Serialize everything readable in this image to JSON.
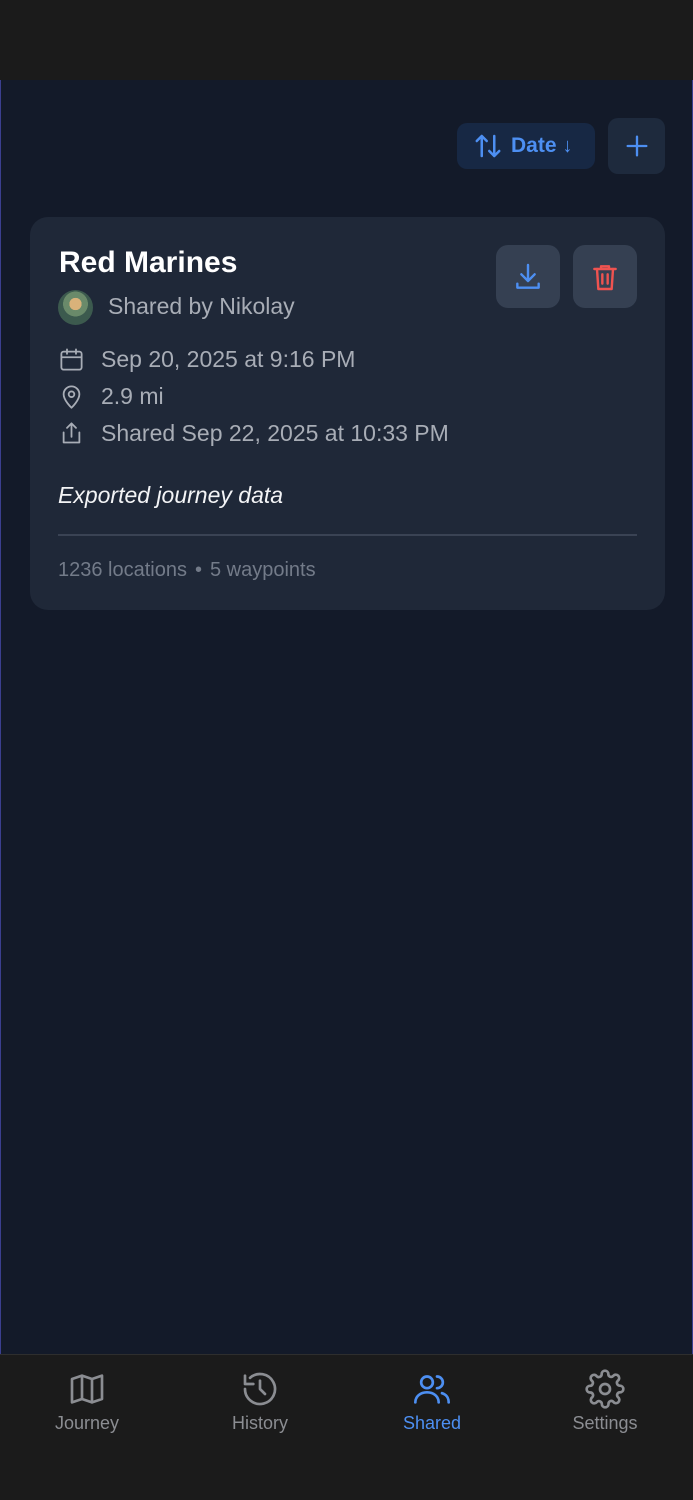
{
  "toolbar": {
    "sort_label": "Date",
    "sort_direction": "↓",
    "sort_icon": "arrows-up-down-icon",
    "add_icon": "plus-icon"
  },
  "card": {
    "title": "Red Marines",
    "shared_by": "Shared by Nikolay",
    "date": "Sep 20, 2025 at 9:16 PM",
    "distance": "2.9 mi",
    "shared_at": "Shared Sep 22, 2025 at 10:33 PM",
    "description": "Exported journey data",
    "locations": "1236 locations",
    "separator": "•",
    "waypoints": "5 waypoints"
  },
  "tabs": [
    {
      "label": "Journey",
      "icon": "map-icon",
      "active": false
    },
    {
      "label": "History",
      "icon": "history-icon",
      "active": false
    },
    {
      "label": "Shared",
      "icon": "users-icon",
      "active": true
    },
    {
      "label": "Settings",
      "icon": "gear-icon",
      "active": false
    }
  ],
  "colors": {
    "accent": "#4d8ff2",
    "danger": "#ef5350",
    "background": "#131a29",
    "card": "#1f2838"
  }
}
